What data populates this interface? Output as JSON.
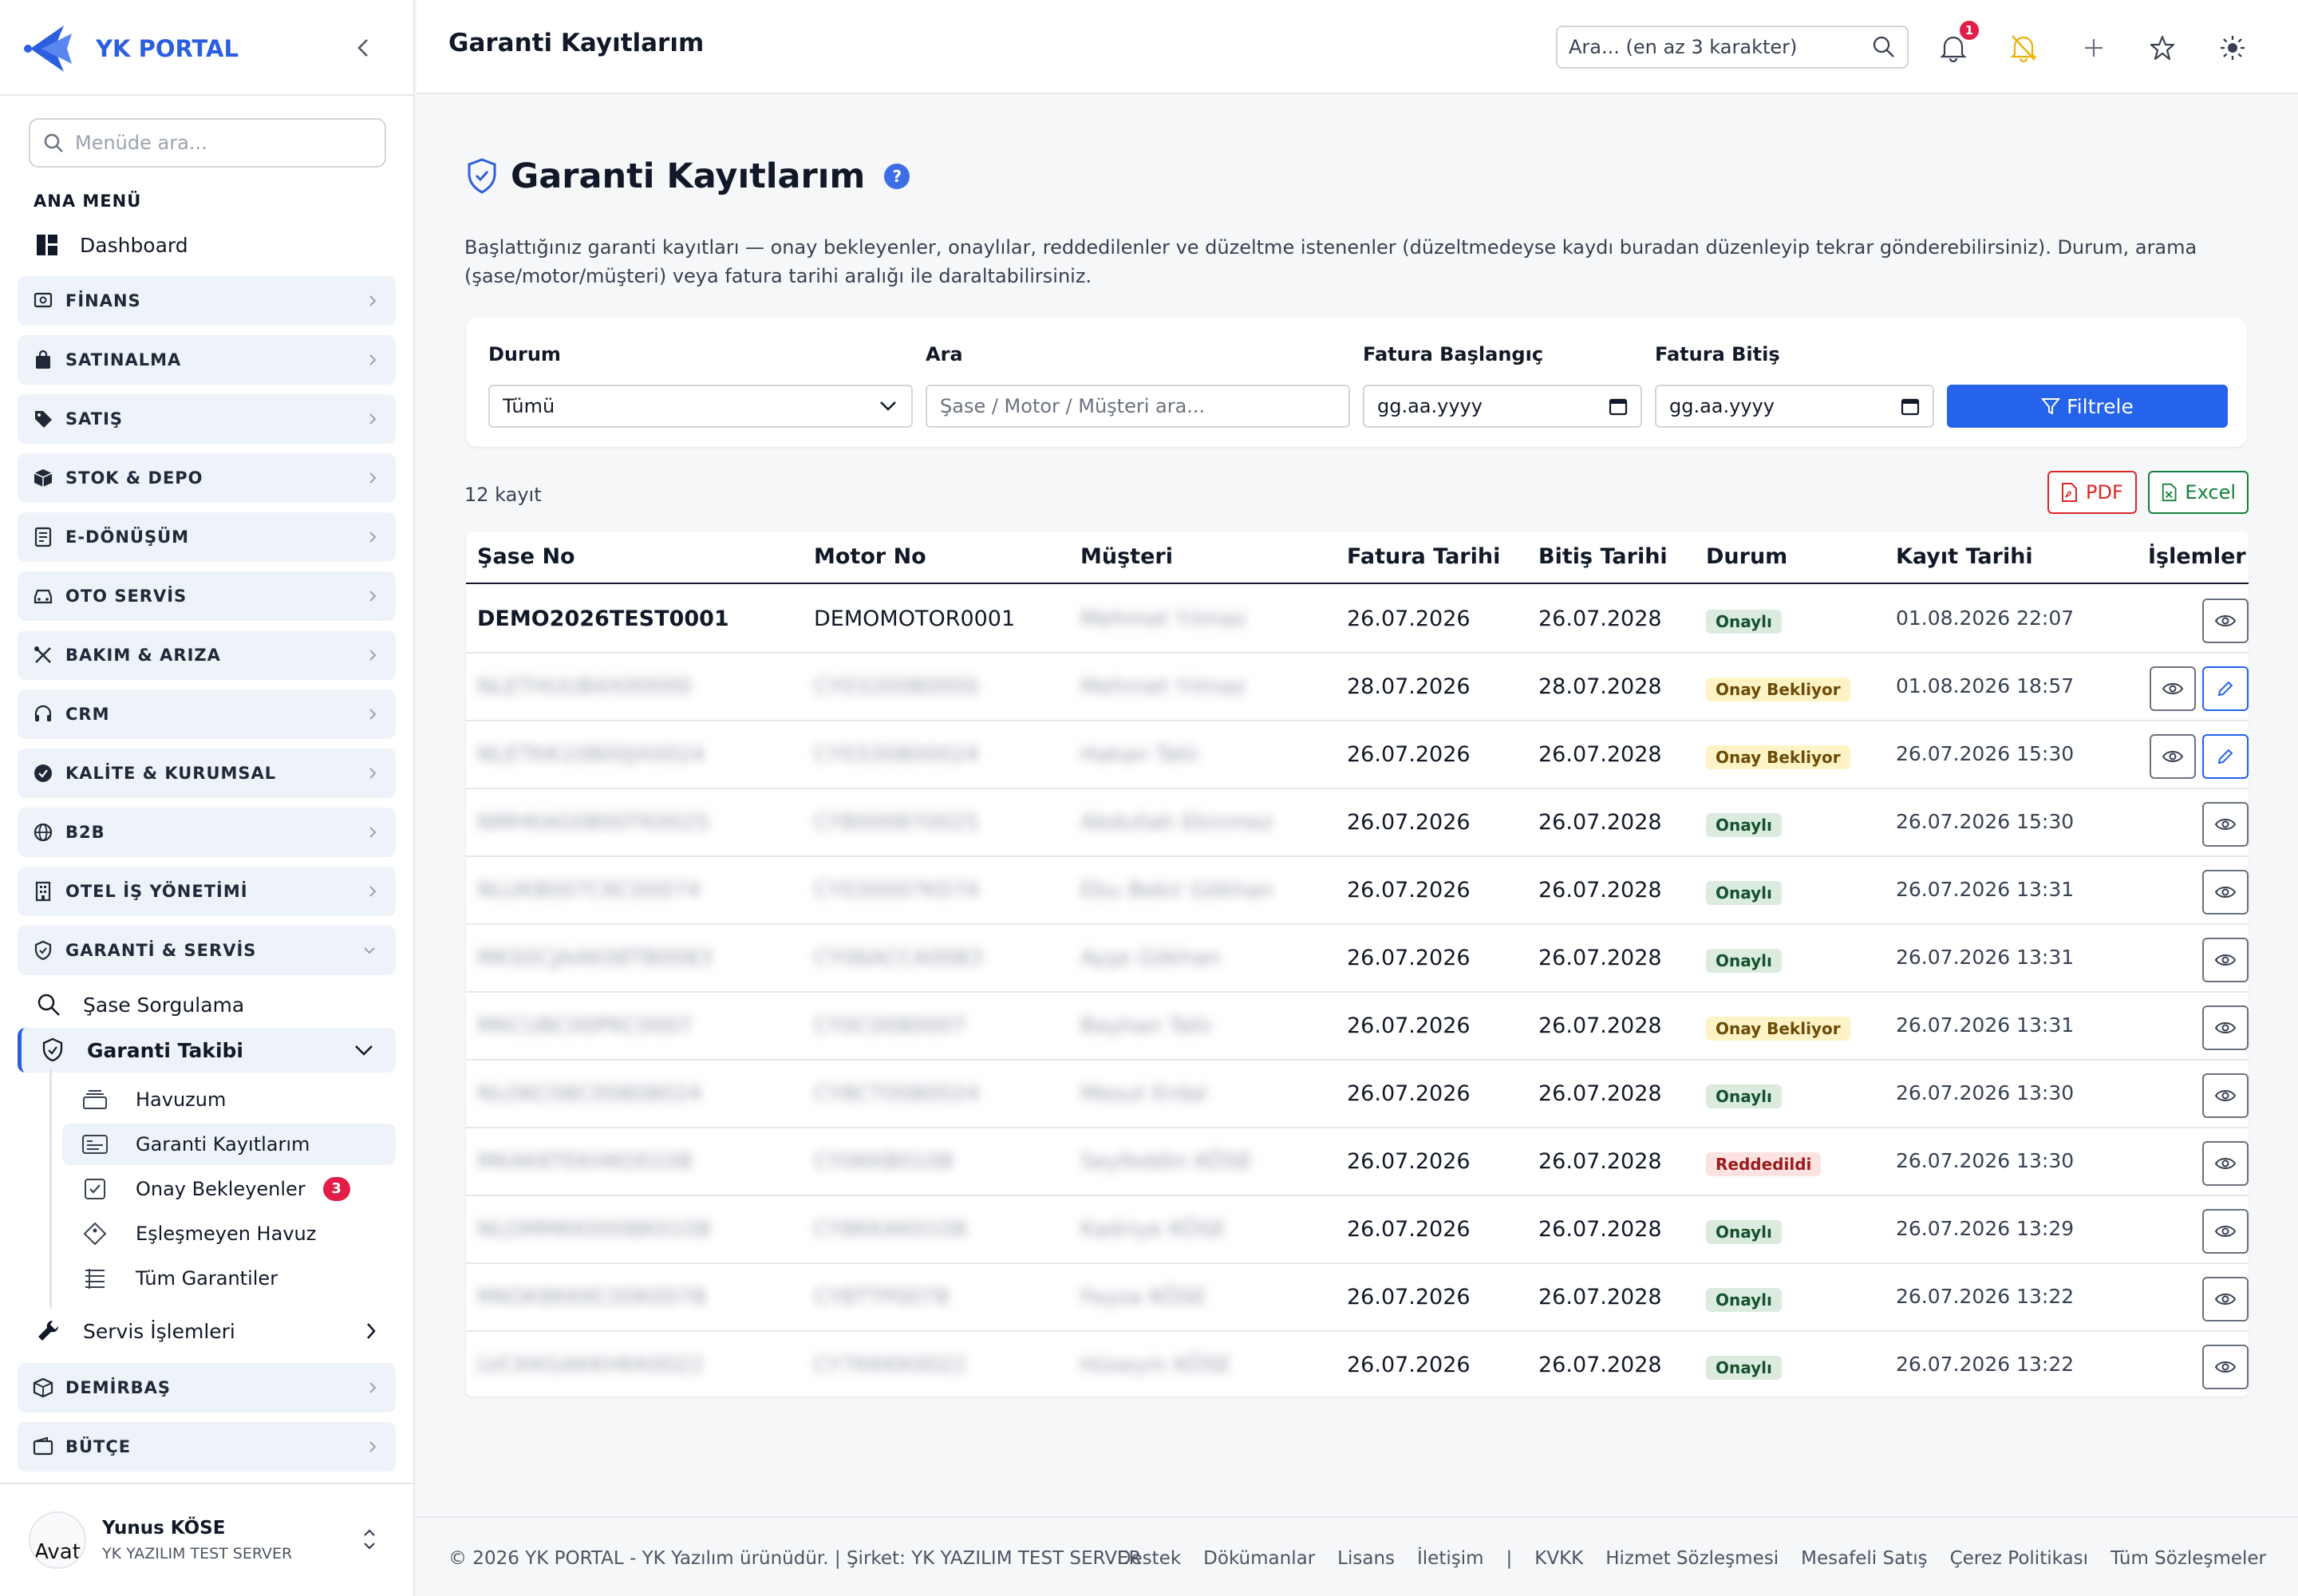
{
  "app": {
    "name": "YK PORTAL"
  },
  "sidebar": {
    "search_placeholder": "Menüde ara...",
    "section_title": "ANA MENÜ",
    "dashboard": "Dashboard",
    "categories": {
      "finans": "FİNANS",
      "satinalma": "SATINALMA",
      "satis": "SATIŞ",
      "stok": "STOK & DEPO",
      "edonusum": "E-DÖNÜŞÜM",
      "oto": "OTO SERVİS",
      "bakim": "BAKIM & ARIZA",
      "crm": "CRM",
      "kalite": "KALİTE & KURUMSAL",
      "b2b": "B2B",
      "otel": "OTEL İŞ YÖNETİMİ",
      "garanti": "GARANTİ & SERVİS",
      "demirbas": "DEMİRBAŞ",
      "butce": "BÜTÇE"
    },
    "garanti_sub": {
      "sase": "Şase Sorgulama",
      "takibi": "Garanti Takibi",
      "servis": "Servis İşlemleri"
    },
    "takibi_items": {
      "havuzum": "Havuzum",
      "kayitlarim": "Garanti Kayıtlarım",
      "onay": "Onay Bekleyenler",
      "onay_count": "3",
      "eslesmeyen": "Eşleşmeyen Havuz",
      "tum": "Tüm Garantiler"
    },
    "user": {
      "avatar_alt": "Avat",
      "name": "Yunus KÖSE",
      "company": "YK YAZILIM TEST SERVER"
    }
  },
  "topbar": {
    "title": "Garanti Kayıtlarım",
    "search_placeholder": "Ara... (en az 3 karakter)",
    "notif_count": "1"
  },
  "page": {
    "title": "Garanti Kayıtlarım",
    "help": "?",
    "description": "Başlattığınız garanti kayıtları — onay bekleyenler, onaylılar, reddedilenler ve düzeltme istenenler (düzeltmedeyse kaydı buradan düzenleyip tekrar gönderebilirsiniz). Durum, arama (şase/motor/müşteri) veya fatura tarihi aralığı ile daraltabilirsiniz."
  },
  "filters": {
    "status_label": "Durum",
    "status_value": "Tümü",
    "search_label": "Ara",
    "search_placeholder": "Şase / Motor / Müşteri ara...",
    "start_label": "Fatura Başlangıç",
    "start_placeholder": "gg.aa.yyyy",
    "end_label": "Fatura Bitiş",
    "end_placeholder": "gg.aa.yyyy",
    "button": "Filtrele"
  },
  "results": {
    "count_text": "12 kayıt",
    "pdf": "PDF",
    "excel": "Excel"
  },
  "table": {
    "headers": {
      "sase": "Şase No",
      "motor": "Motor No",
      "musteri": "Müşteri",
      "fatura": "Fatura Tarihi",
      "bitis": "Bitiş Tarihi",
      "durum": "Durum",
      "kayit": "Kayıt Tarihi",
      "islemler": "İşlemler"
    },
    "rows": [
      {
        "sase": "DEMO2026TEST0001",
        "motor": "DEMOMOTOR0001",
        "musteri": "Mehmet Yılmaz",
        "fatura": "26.07.2026",
        "bitis": "26.07.2028",
        "durum": "Onaylı",
        "kayit": "01.08.2026 22:07"
      },
      {
        "sase": "NLETHUUB4X00000",
        "motor": "CY0320080000",
        "musteri": "Mehmet Yılmaz",
        "fatura": "28.07.2026",
        "bitis": "28.07.2028",
        "durum": "Onay Bekliyor",
        "kayit": "01.08.2026 18:57"
      },
      {
        "sase": "NLETKK10800JX0024",
        "motor": "CY0330800024",
        "musteri": "Hakan Tatlı",
        "fatura": "26.07.2026",
        "bitis": "26.07.2028",
        "durum": "Onay Bekliyor",
        "kayit": "26.07.2026 15:30"
      },
      {
        "sase": "NMHKAG0800TK0025",
        "motor": "CY8000870025",
        "musteri": "Abdullah Ekinmez",
        "fatura": "26.07.2026",
        "bitis": "26.07.2028",
        "durum": "Onaylı",
        "kayit": "26.07.2026 15:30"
      },
      {
        "sase": "NLUK8007CKC00074",
        "motor": "CY030007K074",
        "musteri": "Ebu Bekir Gökhan",
        "fatura": "26.07.2026",
        "bitis": "26.07.2028",
        "durum": "Onaylı",
        "kayit": "26.07.2026 13:31"
      },
      {
        "sase": "MKS0CJAAK08TB0083",
        "motor": "CY06ACCA0083",
        "musteri": "Ayşe Gökhan",
        "fatura": "26.07.2026",
        "bitis": "26.07.2028",
        "durum": "Onaylı",
        "kayit": "26.07.2026 13:31"
      },
      {
        "sase": "MKCUBC00PKC0007",
        "motor": "CY0C0080007",
        "musteri": "Bayhan Tatlı",
        "fatura": "26.07.2026",
        "bitis": "26.07.2028",
        "durum": "Onay Bekliyor",
        "kayit": "26.07.2026 13:31"
      },
      {
        "sase": "NLOKC08C00808024",
        "motor": "CY8CT0080024",
        "musteri": "Mesut Erdal",
        "fatura": "26.07.2026",
        "bitis": "26.07.2028",
        "durum": "Onaylı",
        "kayit": "26.07.2026 13:30"
      },
      {
        "sase": "MKAKKTEKHKO0108",
        "motor": "CY0KKB0108",
        "musteri": "Seyfeddin KÖSE",
        "fatura": "26.07.2026",
        "bitis": "26.07.2028",
        "durum": "Reddedildi",
        "kayit": "26.07.2026 13:30"
      },
      {
        "sase": "NLOMMKK0008K0108",
        "motor": "CY8KKAK0108",
        "musteri": "Kadriye KÖSE",
        "fatura": "26.07.2026",
        "bitis": "26.07.2028",
        "durum": "Onaylı",
        "kayit": "26.07.2026 13:29"
      },
      {
        "sase": "MKOK8KKKC00K0078",
        "motor": "CY8TTP0078",
        "musteri": "Feyza KÖSE",
        "fatura": "26.07.2026",
        "bitis": "26.07.2028",
        "durum": "Onaylı",
        "kayit": "26.07.2026 13:22"
      },
      {
        "sase": "LVCKKGAKKHKK0022",
        "motor": "CY7KKKK0022",
        "musteri": "Hüseyin KÖSE",
        "fatura": "26.07.2026",
        "bitis": "26.07.2028",
        "durum": "Onaylı",
        "kayit": "26.07.2026 13:22"
      }
    ]
  },
  "footer": {
    "copyright": "© 2026 YK PORTAL - YK Yazılım ürünüdür. | Şirket: YK YAZILIM TEST SERVER",
    "links": {
      "destek": "Destek",
      "dok": "Dökümanlar",
      "lisans": "Lisans",
      "iletisim": "İletişim",
      "sep": "|",
      "kvkk": "KVKK",
      "hizmet": "Hizmet Sözleşmesi",
      "mesafeli": "Mesafeli Satış",
      "cerez": "Çerez Politikası",
      "tum": "Tüm Sözleşmeler"
    }
  },
  "colors": {
    "brand": "#2c5fe0",
    "primary": "#2563eb",
    "approved": "#dcebe0",
    "pending": "#fdf3c4",
    "rejected": "#fde2e2"
  }
}
